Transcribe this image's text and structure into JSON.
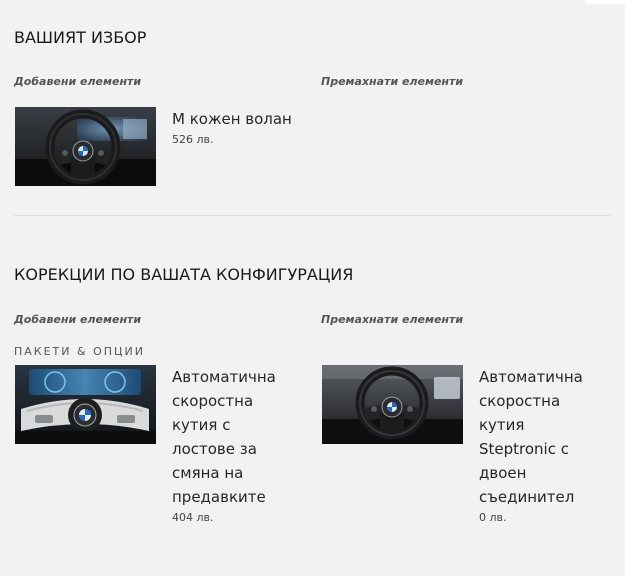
{
  "selection": {
    "title": "ВАШИЯТ ИЗБОР",
    "added_label": "Добавени елементи",
    "removed_label": "Премахнати елементи",
    "added_items": [
      {
        "name": "M кожен волан",
        "price": "526 лв."
      }
    ]
  },
  "corrections": {
    "title": "КОРЕКЦИИ ПО ВАШАТА КОНФИГУРАЦИЯ",
    "added_label": "Добавени елементи",
    "removed_label": "Премахнати елементи",
    "category": "ПАКЕТИ & ОПЦИИ",
    "added_items": [
      {
        "name": "Автоматична скоростна кутия с лостове за смяна на предавките",
        "price": "404 лв."
      }
    ],
    "removed_items": [
      {
        "name": "Автоматична скоростна кутия Steptronic с двоен съединител",
        "price": "0 лв."
      }
    ]
  }
}
